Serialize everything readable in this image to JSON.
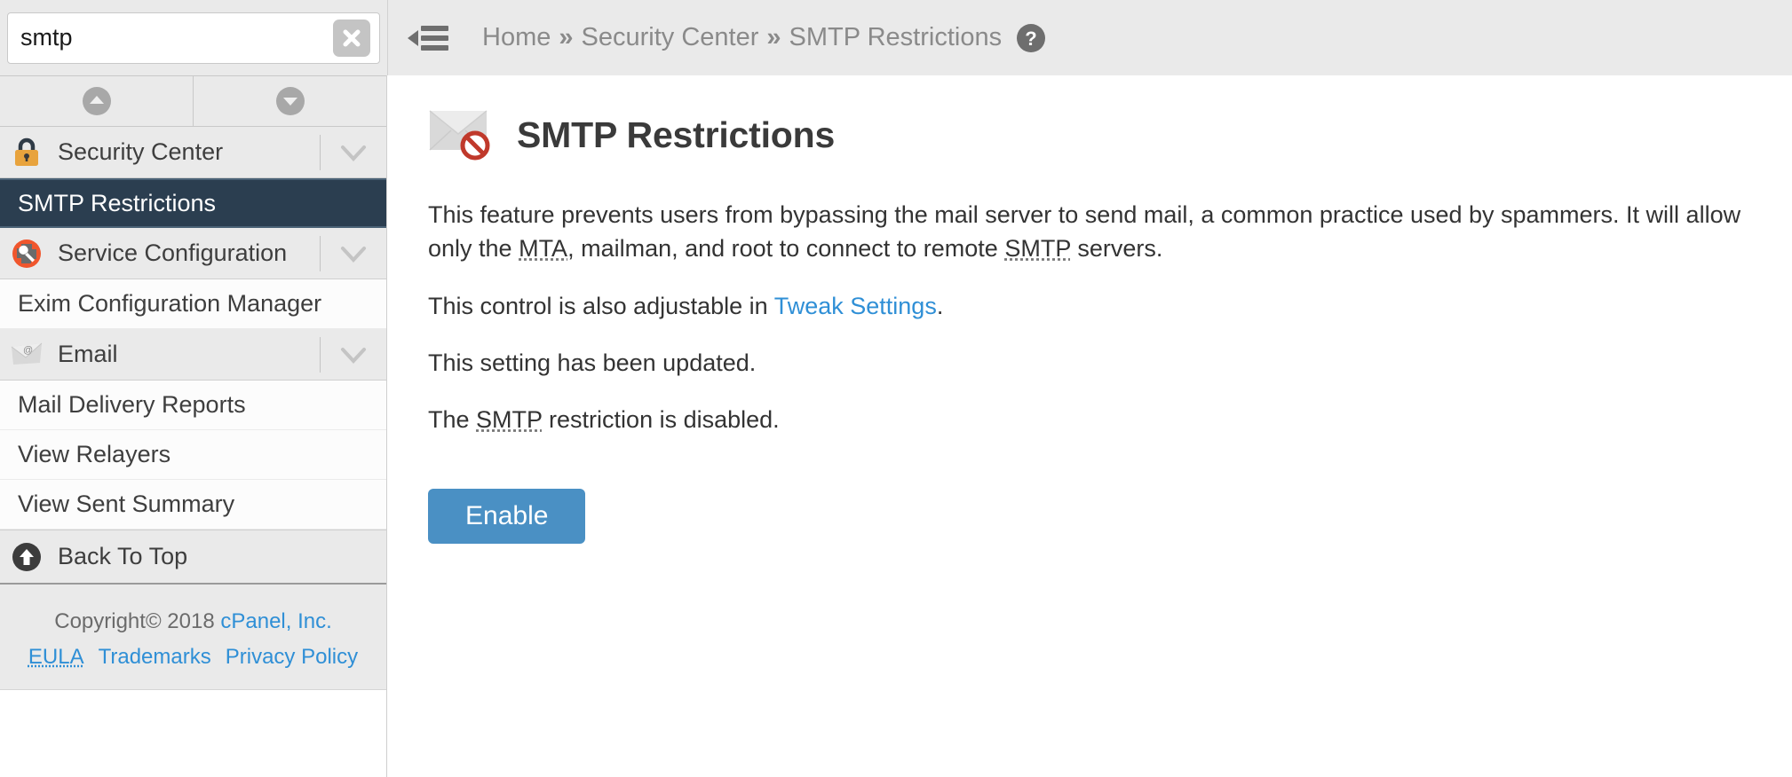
{
  "search": {
    "value": "smtp",
    "placeholder": "Search",
    "clear_icon": "close-icon"
  },
  "header": {
    "menu_icon": "hamburger-collapse-icon",
    "help_icon": "help-question-icon",
    "breadcrumb": {
      "separator": "»",
      "items": [
        {
          "label": "Home"
        },
        {
          "label": "Security Center"
        },
        {
          "label": "SMTP Restrictions"
        }
      ]
    }
  },
  "sidebar": {
    "expanders": {
      "collapse_all_icon": "chevron-up-circle-icon",
      "expand_all_icon": "chevron-down-circle-icon"
    },
    "groups": [
      {
        "label": "Security Center",
        "icon": "padlock-icon",
        "chevron": "chevron-down-icon",
        "items": [
          {
            "label": "SMTP Restrictions",
            "selected": true
          }
        ]
      },
      {
        "label": "Service Configuration",
        "icon": "wrench-gear-icon",
        "chevron": "chevron-down-icon",
        "items": [
          {
            "label": "Exim Configuration Manager",
            "selected": false
          }
        ]
      },
      {
        "label": "Email",
        "icon": "envelope-at-icon",
        "chevron": "chevron-down-icon",
        "items": [
          {
            "label": "Mail Delivery Reports",
            "selected": false
          },
          {
            "label": "View Relayers",
            "selected": false
          },
          {
            "label": "View Sent Summary",
            "selected": false
          }
        ]
      }
    ],
    "back_to_top": {
      "label": "Back To Top",
      "icon": "arrow-up-circle-icon"
    },
    "footer": {
      "copyright_text": "Copyright© 2018 ",
      "company_link": "cPanel, Inc.",
      "links": [
        {
          "label": "EULA"
        },
        {
          "label": "Trademarks"
        },
        {
          "label": "Privacy Policy"
        }
      ]
    }
  },
  "main": {
    "icon": "envelope-blocked-icon",
    "title": "SMTP Restrictions",
    "paragraph1": {
      "part1": "This feature prevents users from bypassing the mail server to send mail, a common practice used by spammers. It will allow only the ",
      "abbr1": "MTA",
      "part2": ", mailman, and root to connect to remote ",
      "abbr2": "SMTP",
      "part3": " servers."
    },
    "paragraph2": {
      "part1": "This control is also adjustable in ",
      "link": "Tweak Settings",
      "part2": "."
    },
    "paragraph3": "This setting has been updated.",
    "paragraph4": {
      "part1": "The ",
      "abbr": "SMTP",
      "part2": " restriction is disabled."
    },
    "enable_button": "Enable"
  },
  "colors": {
    "accent_blue": "#4a90c4",
    "link_blue": "#2f8fd6",
    "selected_nav_bg": "#2b3e50",
    "panel_grey": "#eaeaea",
    "lock_orange": "#e8a33d",
    "wrench_orange": "#f0562d",
    "deny_red": "#c0392b"
  }
}
